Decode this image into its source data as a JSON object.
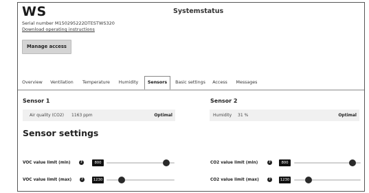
{
  "header": {
    "app_title": "WS",
    "serial": "Serial number M150295222DTESTWS320",
    "download_link": "Download operating instructions",
    "page_title": "Systemstatus",
    "manage_button": "Manage access"
  },
  "tabs": [
    {
      "label": "Overview"
    },
    {
      "label": "Ventilation"
    },
    {
      "label": "Temperature"
    },
    {
      "label": "Humidity"
    },
    {
      "label": "Sensors",
      "active": true
    },
    {
      "label": "Basic settings"
    },
    {
      "label": "Access"
    },
    {
      "label": "Messages"
    }
  ],
  "sensors": [
    {
      "title": "Sensor 1",
      "measure": "Air quality (CO2)",
      "value": "1163 ppm",
      "status": "Optimal"
    },
    {
      "title": "Sensor 2",
      "measure": "Humidity",
      "value": "31 %",
      "status": "Optimal"
    }
  ],
  "settings": {
    "title": "Sensor settings",
    "help_glyph": "?",
    "items": [
      {
        "label": "VOC value limit (min)",
        "value": "800",
        "level": 0.88
      },
      {
        "label": "VOC value limit (max)",
        "value": "1230",
        "level": 0.22
      },
      {
        "label": "CO2 value limit (min)",
        "value": "800",
        "level": 0.88
      },
      {
        "label": "CO2 value limit (max)",
        "value": "1230",
        "level": 0.22
      }
    ]
  }
}
